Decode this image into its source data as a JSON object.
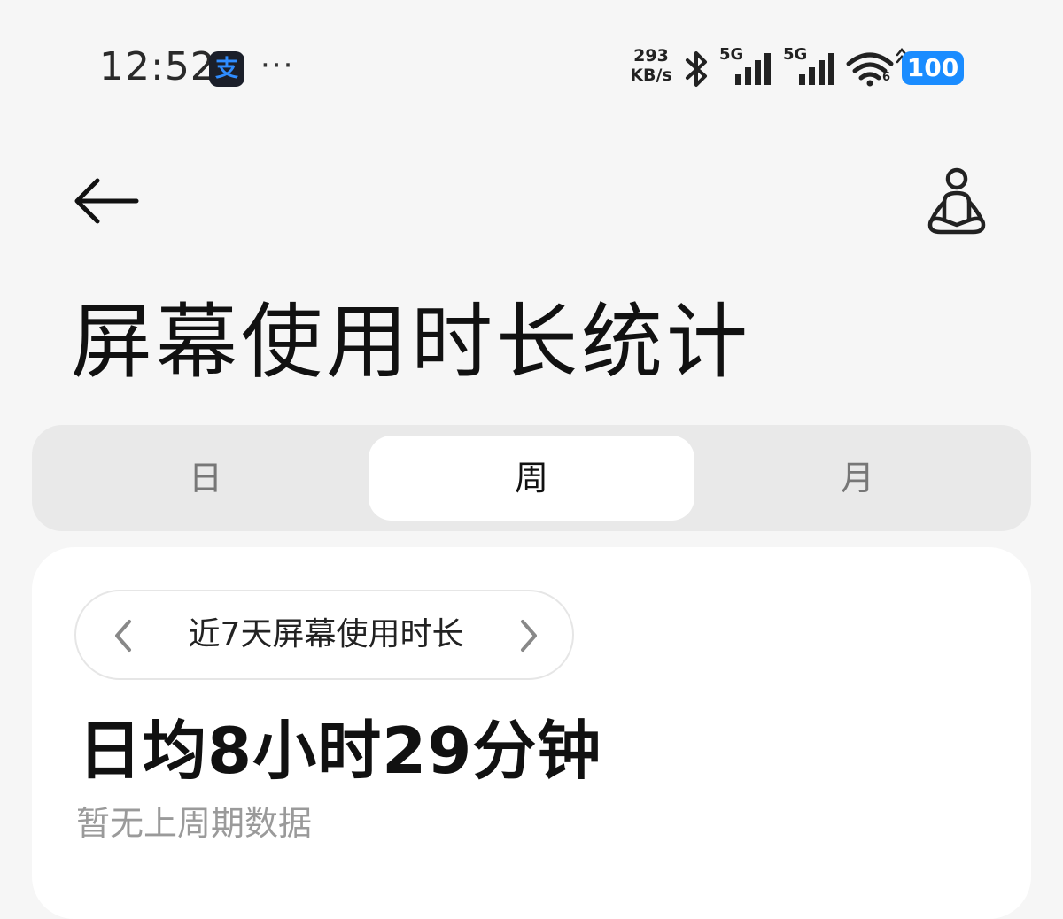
{
  "status_bar": {
    "time": "12:52",
    "app_icon_glyph": "支",
    "more_indicator": "···",
    "net_speed_value": "293",
    "net_speed_unit": "KB/s",
    "sim1_type": "5G",
    "sim2_type": "5G",
    "wifi_badge": "6",
    "battery_level": "100",
    "battery_color": "#1a8cff",
    "icons": [
      "bluetooth-icon",
      "signal-icon",
      "wifi-icon",
      "charging-icon",
      "battery-icon"
    ]
  },
  "header": {
    "back_icon": "arrow-left-icon",
    "action_icon": "meditation-icon",
    "title": "屏幕使用时长统计"
  },
  "tabs": [
    {
      "label": "日",
      "active": false
    },
    {
      "label": "周",
      "active": true
    },
    {
      "label": "月",
      "active": false
    }
  ],
  "summary_card": {
    "range_label": "近7天屏幕使用时长",
    "prev_icon": "chevron-left-icon",
    "next_icon": "chevron-right-icon",
    "average_usage": "日均8小时29分钟",
    "comparison_note": "暂无上周期数据"
  }
}
